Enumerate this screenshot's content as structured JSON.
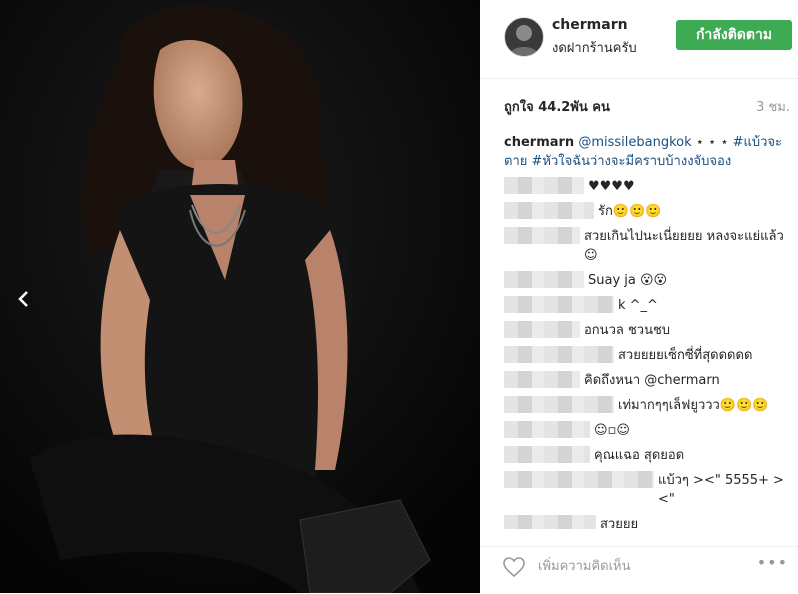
{
  "header": {
    "username": "chermarn",
    "location": "งดฝากร้านครับ",
    "follow_label": "กำลังติดตาม"
  },
  "post": {
    "likes": "ถูกใจ 44.2พัน คน",
    "time_ago": "3 ชม.",
    "caption": {
      "username": "chermarn",
      "mention": "@missilebangkok",
      "body": " ⋆ ⋆ ⋆ ",
      "tags": "#แบ้วจะตาย #หัวใจฉันว่างจะมีคราบบ้างงจับจอง"
    }
  },
  "comments": [
    {
      "text": "♥♥♥♥",
      "blur": 80
    },
    {
      "text": "รัก🙂🙂🙂",
      "blur": 90
    },
    {
      "text": "สวยเกินไปนะเนี่ยยยย หลงจะแย่แล้ว☺",
      "blur": 76
    },
    {
      "text": "Suay ja 😮😮",
      "blur": 80
    },
    {
      "text": "k ^_^",
      "blur": 110
    },
    {
      "text": "อกนวล ชวนชบ",
      "blur": 76
    },
    {
      "text": "สวยยยยเซ็กซี่ที่สุดดดดด",
      "blur": 110
    },
    {
      "text": "คิดถึงหนา @chermarn",
      "blur": 76
    },
    {
      "text": "เท่มากๆๆเล็ฟยูววว🙂🙂🙂",
      "blur": 110
    },
    {
      "text": "☺▫☺",
      "blur": 86
    },
    {
      "text": "คุณแฉอ สุดยอด",
      "blur": 86
    },
    {
      "text": "แบ้วๆ ><\" 5555+ > <\"",
      "blur": 150
    },
    {
      "text": "สวยยย",
      "blur": 92
    }
  ],
  "footer": {
    "add_comment_placeholder": "เพิ่มความคิดเห็น",
    "more_label": "•••"
  },
  "colors": {
    "follow_bg": "#3faa54",
    "link": "#1a4f80",
    "photo_bg": "#0b0b0b"
  },
  "icons": {
    "prev": "chevron-left-icon",
    "like": "heart-outline-icon",
    "more": "more-options-icon"
  }
}
